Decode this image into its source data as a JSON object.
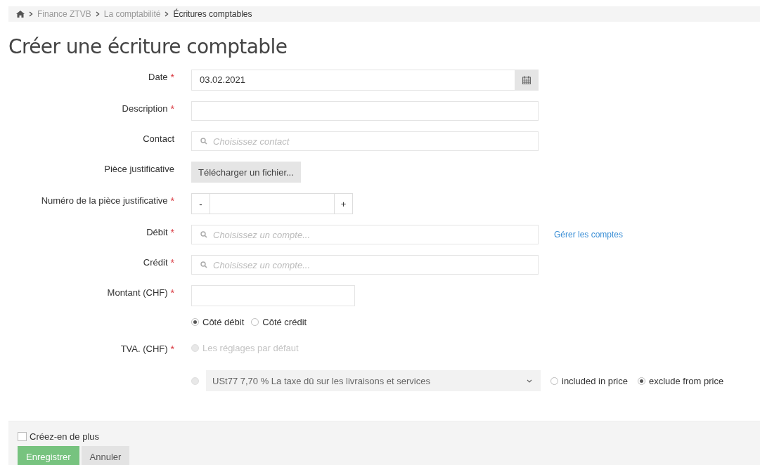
{
  "breadcrumb": [
    {
      "label": "Finance ZTVB",
      "current": false
    },
    {
      "label": "La comptabilité",
      "current": false
    },
    {
      "label": "Écritures comptables",
      "current": true
    }
  ],
  "title": "Créer une écriture comptable",
  "fields": [
    {
      "kind": "date",
      "label": "Date",
      "required_mark": "*",
      "value": "03.02.2021"
    },
    {
      "kind": "text",
      "label": "Description",
      "required_mark": "*"
    },
    {
      "kind": "search",
      "label": "Contact",
      "placeholder": "Choisissez contact"
    },
    {
      "kind": "upload",
      "label": "Pièce justificative",
      "button": "Télécharger un fichier..."
    },
    {
      "kind": "stepper",
      "label": "Numéro de la pièce justificative",
      "required_mark": "*",
      "minus": "-",
      "plus": "+"
    },
    {
      "kind": "search",
      "label": "Débit",
      "required_mark": "*",
      "placeholder": "Choisissez un compte...",
      "link": "Gérer les comptes"
    },
    {
      "kind": "search",
      "label": "Crédit",
      "required_mark": "*",
      "placeholder": "Choisissez un compte..."
    },
    {
      "kind": "amount",
      "label": "Montant (CHF)",
      "required_mark": "*"
    },
    {
      "kind": "radios",
      "options": [
        {
          "label": "Côté débit",
          "selected": true
        },
        {
          "label": "Côté crédit",
          "selected": false
        }
      ]
    },
    {
      "kind": "tva",
      "label": "TVA. (CHF)",
      "required_mark": "*",
      "default_option": {
        "label": "Les réglages par défaut",
        "selected": false,
        "disabled": true
      }
    },
    {
      "kind": "tax",
      "selected": false,
      "value": "USt77 7,70 % La taxe dû sur les livraisons et services",
      "options": [
        {
          "label": "included in price",
          "selected": false
        },
        {
          "label": "exclude from price",
          "selected": true
        }
      ]
    }
  ],
  "footer": {
    "checkbox": {
      "label": "Créez-en de plus",
      "checked": false
    },
    "buttons": [
      {
        "label": "Enregistrer",
        "kind": "primary"
      },
      {
        "label": "Annuler",
        "kind": "secondary"
      }
    ]
  }
}
